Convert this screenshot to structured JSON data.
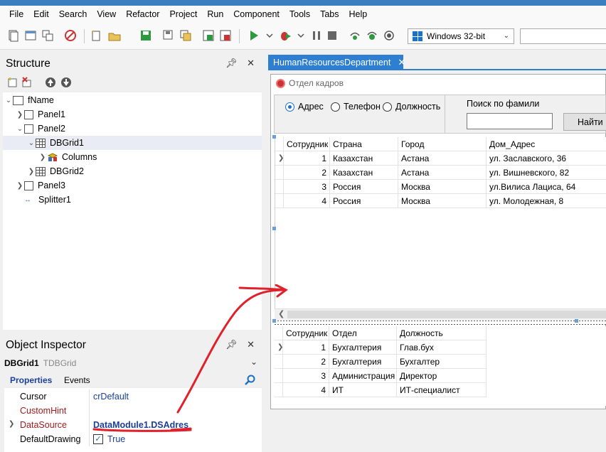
{
  "menu": [
    "File",
    "Edit",
    "Search",
    "View",
    "Refactor",
    "Project",
    "Run",
    "Component",
    "Tools",
    "Tabs",
    "Help"
  ],
  "toolbar": {
    "icons": [
      "new-items-icon",
      "new-form-icon",
      "clone-icon",
      "remove-icon",
      "new-icon",
      "open-icon",
      "save-icon",
      "save-as-icon",
      "save-all-icon",
      "add-to-project-icon",
      "remove-from-project-icon",
      "run-icon",
      "debug-icon",
      "pause-icon",
      "stop-icon",
      "step-over-icon",
      "trace-into-icon",
      "run-to-cursor-icon"
    ],
    "platform": "Windows 32-bit",
    "search_value": ""
  },
  "structure": {
    "title": "Structure",
    "tree": [
      {
        "label": "fName"
      },
      {
        "label": "Panel1"
      },
      {
        "label": "Panel2"
      },
      {
        "label": "DBGrid1"
      },
      {
        "label": "Columns"
      },
      {
        "label": "DBGrid2"
      },
      {
        "label": "Panel3"
      },
      {
        "label": "Splitter1"
      }
    ]
  },
  "object_inspector": {
    "title": "Object Inspector",
    "selected_name": "DBGrid1",
    "selected_type": "TDBGrid",
    "tabs": {
      "properties": "Properties",
      "events": "Events"
    },
    "properties": [
      {
        "name": "Cursor",
        "value": "crDefault"
      },
      {
        "name": "CustomHint",
        "value": ""
      },
      {
        "name": "DataSource",
        "value": "DataModule1.DSAdres"
      },
      {
        "name": "DefaultDrawing",
        "value": "True"
      }
    ]
  },
  "designer": {
    "tab_title": "HumanResourcesDepartment",
    "form_caption": "Отдел кадров",
    "radios": [
      {
        "label": "Адрес",
        "checked": true
      },
      {
        "label": "Телефон",
        "checked": false
      },
      {
        "label": "Должность",
        "checked": false
      }
    ],
    "search_label": "Поиск по фамили",
    "search_value": "",
    "find_button": "Найти",
    "grid1": {
      "headers": [
        "Сотрудник",
        "Страна",
        "Город",
        "Дом_Адрес"
      ],
      "rows": [
        [
          "1",
          "Казахстан",
          "Астана",
          "ул. Заславского, 36"
        ],
        [
          "2",
          "Казахстан",
          "Астана",
          "ул. Вишневского, 82"
        ],
        [
          "3",
          "Россия",
          "Москва",
          "ул.Вилиса Лациса, 64"
        ],
        [
          "4",
          "Россия",
          "Москва",
          "ул. Молодежная, 8"
        ]
      ]
    },
    "grid2": {
      "headers": [
        "Сотрудник",
        "Отдел",
        "Должность"
      ],
      "rows": [
        [
          "1",
          "Бухгалтерия",
          "Глав.бух"
        ],
        [
          "2",
          "Бухгалтерия",
          "Бухгалтер"
        ],
        [
          "3",
          "Администрация",
          "Директор"
        ],
        [
          "4",
          "ИТ",
          "ИТ-специалист"
        ]
      ]
    }
  },
  "colors": {
    "accent": "#2e7fd1",
    "annotation": "#e0202a",
    "link": "#1b3f9c"
  }
}
